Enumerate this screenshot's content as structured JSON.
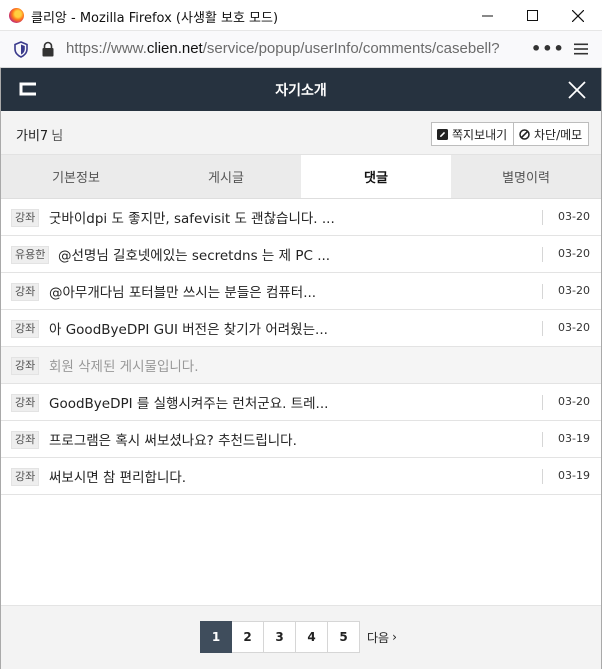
{
  "window": {
    "title": "클리앙 - Mozilla Firefox (사생활 보호 모드)"
  },
  "addressbar": {
    "url_prefix": "https://www.",
    "url_host": "clien.net",
    "url_path": "/service/popup/userInfo/comments/casebell?",
    "more": "•••"
  },
  "popup": {
    "title": "자기소개"
  },
  "user": {
    "name": "가비7",
    "suffix": "님",
    "message_button": "쪽지보내기",
    "block_button": "차단/메모"
  },
  "tabs": [
    {
      "label": "기본정보",
      "active": false
    },
    {
      "label": "게시글",
      "active": false
    },
    {
      "label": "댓글",
      "active": true
    },
    {
      "label": "별명이력",
      "active": false
    }
  ],
  "comments": [
    {
      "badge": "강좌",
      "text": "굿바이dpi 도 좋지만, safevisit 도 괜찮습니다. ...",
      "date": "03-20"
    },
    {
      "badge": "유용한",
      "text": "@선명님 길호넷에있는 secretdns 는 제 PC ...",
      "date": "03-20"
    },
    {
      "badge": "강좌",
      "text": "@아무개다님 포터블만 쓰시는 분들은 컴퓨터...",
      "date": "03-20"
    },
    {
      "badge": "강좌",
      "text": "아 GoodByeDPI GUI 버전은 찾기가 어려웠는...",
      "date": "03-20"
    },
    {
      "badge": "강좌",
      "text": "회원 삭제된 게시물입니다.",
      "date": ""
    },
    {
      "badge": "강좌",
      "text": "GoodByeDPI 를 실행시켜주는 런처군요. 트레...",
      "date": "03-20"
    },
    {
      "badge": "강좌",
      "text": "프로그램은 혹시 써보셨나요? 추천드립니다.",
      "date": "03-19"
    },
    {
      "badge": "강좌",
      "text": "써보시면 참 편리합니다.",
      "date": "03-19"
    }
  ],
  "pagination": {
    "pages": [
      "1",
      "2",
      "3",
      "4",
      "5"
    ],
    "current": "1",
    "next": "다음",
    "next_icon": "›"
  }
}
